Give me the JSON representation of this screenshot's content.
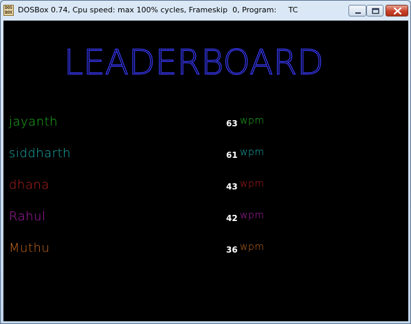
{
  "window": {
    "title": "DOSBox 0.74, Cpu speed: max 100% cycles, Frameskip  0, Program:     TC",
    "icon_text": "DOS BOX"
  },
  "leaderboard": {
    "heading": "LEADERBOARD",
    "heading_color": "#3a3aff",
    "entries": [
      {
        "name": "jayanth",
        "score": "63",
        "unit": "wpm",
        "color": "#22b822"
      },
      {
        "name": "siddharth",
        "score": "61",
        "unit": "wpm",
        "color": "#1fb0b0"
      },
      {
        "name": "dhana",
        "score": "43",
        "unit": "wpm",
        "color": "#b82020"
      },
      {
        "name": "Rahul",
        "score": "42",
        "unit": "wpm",
        "color": "#b020b0"
      },
      {
        "name": "Muthu",
        "score": "36",
        "unit": "wpm",
        "color": "#c86a20"
      }
    ]
  }
}
